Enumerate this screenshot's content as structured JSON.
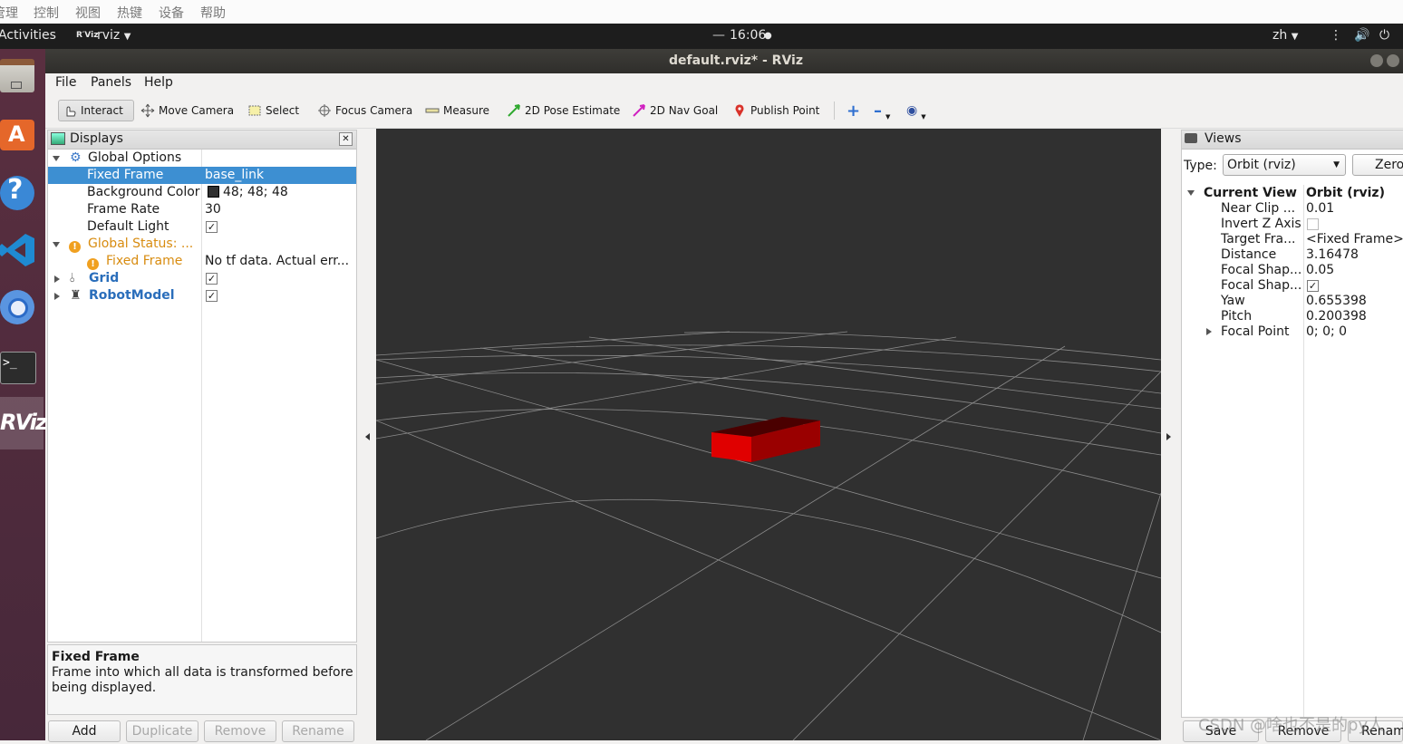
{
  "vbox_menu": [
    "管理",
    "控制",
    "视图",
    "热键",
    "设备",
    "帮助"
  ],
  "topbar": {
    "activities": "Activities",
    "app": "rviz",
    "app_icon": "R′Viz",
    "clock": "16:06",
    "lang": "zh"
  },
  "window": {
    "title": "default.rviz* - RViz"
  },
  "menu": [
    "File",
    "Panels",
    "Help"
  ],
  "toolbar": {
    "interact": "Interact",
    "move_camera": "Move Camera",
    "select": "Select",
    "focus_camera": "Focus Camera",
    "measure": "Measure",
    "pose_estimate": "2D Pose Estimate",
    "nav_goal": "2D Nav Goal",
    "publish_point": "Publish Point"
  },
  "displays": {
    "title": "Displays",
    "global_options": "Global Options",
    "fixed_frame_label": "Fixed Frame",
    "fixed_frame_value": "base_link",
    "bg_color_label": "Background Color",
    "bg_color_value": "48; 48; 48",
    "bg_color_hex": "#303030",
    "frame_rate_label": "Frame Rate",
    "frame_rate_value": "30",
    "default_light_label": "Default Light",
    "default_light_checked": "✓",
    "global_status_label": "Global Status: ...",
    "status_fixed_frame_label": "Fixed Frame",
    "status_fixed_frame_value": "No tf data.  Actual err...",
    "grid_label": "Grid",
    "grid_checked": "✓",
    "robot_label": "RobotModel",
    "robot_checked": "✓",
    "warning_color": "#e8a317",
    "link_color": "#2a6ebb"
  },
  "description": {
    "title": "Fixed Frame",
    "text_line1": "Frame into which all data is transformed before",
    "text_line2": "being displayed."
  },
  "display_buttons": {
    "add": "Add",
    "duplicate": "Duplicate",
    "remove": "Remove",
    "rename": "Rename"
  },
  "views": {
    "title": "Views",
    "type_label": "Type:",
    "type_value": "Orbit (rviz)",
    "zero_button": "Zero",
    "current_view_label": "Current View",
    "current_view_value": "Orbit (rviz)",
    "props": [
      {
        "label": "Near Clip ...",
        "value": "0.01"
      },
      {
        "label": "Invert Z Axis",
        "value": ""
      },
      {
        "label": "Target Fra...",
        "value": "<Fixed Frame>"
      },
      {
        "label": "Distance",
        "value": "3.16478"
      },
      {
        "label": "Focal Shap...",
        "value": "0.05"
      },
      {
        "label": "Focal Shap...",
        "value": "✓"
      },
      {
        "label": "Yaw",
        "value": "0.655398"
      },
      {
        "label": "Pitch",
        "value": "0.200398"
      },
      {
        "label": "Focal Point",
        "value": "0; 0; 0"
      }
    ],
    "save": "Save",
    "remove": "Remove",
    "rename": "Renam"
  },
  "watermark": "CSDN @啥也不是的py人"
}
